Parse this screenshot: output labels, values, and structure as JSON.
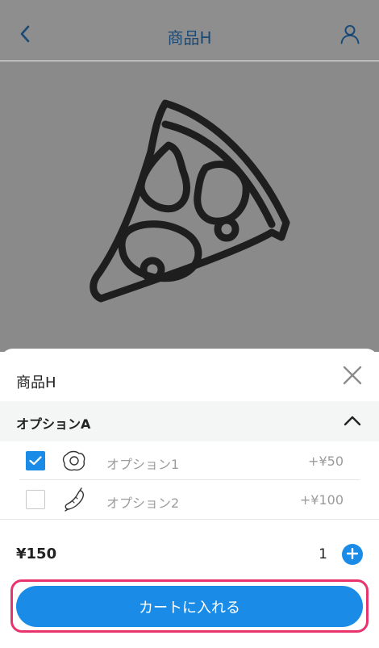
{
  "header": {
    "title": "商品H",
    "back_icon": "chevron-left-icon",
    "user_icon": "user-icon",
    "accent": "#1a4a75"
  },
  "product_image": {
    "icon": "pizza-slice-icon"
  },
  "sheet": {
    "title": "商品H",
    "close_icon": "close-icon",
    "option_group": {
      "label": "オプションA",
      "expanded": true,
      "chevron_icon": "chevron-up-icon",
      "items": [
        {
          "name": "オプション1",
          "price": "+¥50",
          "checked": true,
          "icon": "fried-egg-icon"
        },
        {
          "name": "オプション2",
          "price": "+¥100",
          "checked": false,
          "icon": "sausage-icon"
        }
      ]
    },
    "total": "¥150",
    "quantity": "1",
    "plus_icon": "plus-icon",
    "cart_button_label": "カートに入れる",
    "accent": "#1a8ce8",
    "highlight_color": "#e8336d"
  }
}
